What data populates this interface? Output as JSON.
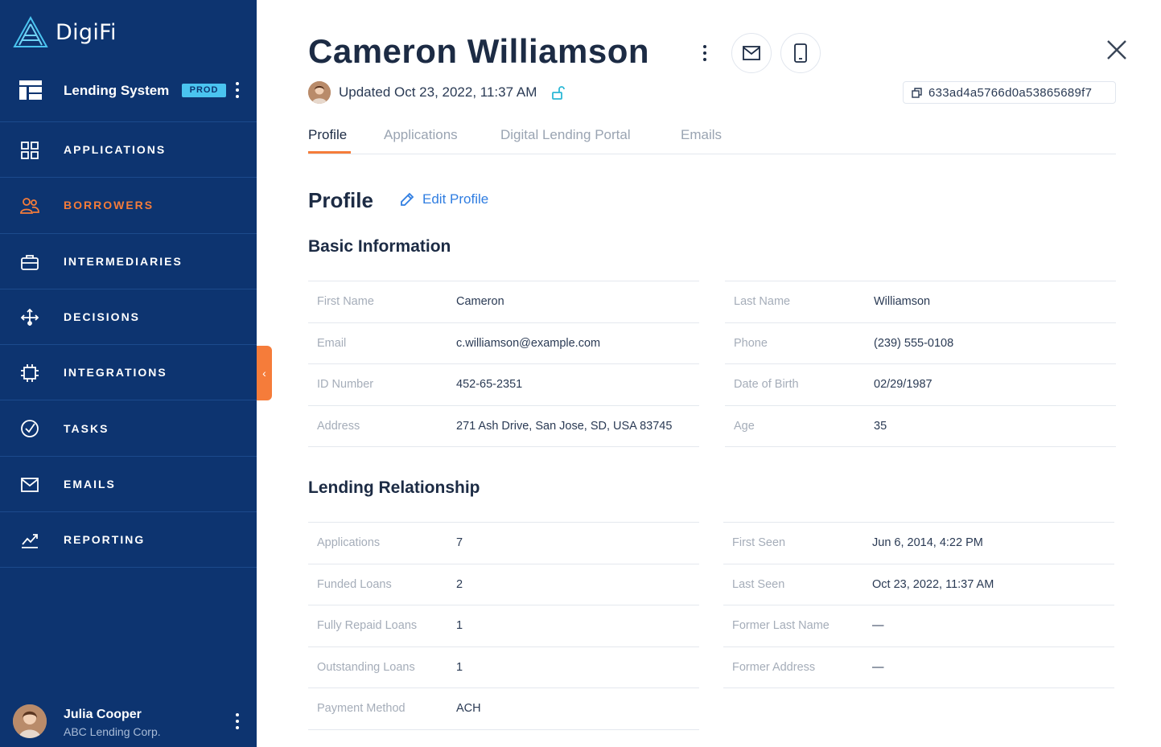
{
  "app": {
    "name": "DigiFi"
  },
  "system": {
    "name": "Lending System",
    "env_badge": "PROD"
  },
  "nav": [
    {
      "label": "APPLICATIONS",
      "icon": "grid-icon",
      "active": false
    },
    {
      "label": "BORROWERS",
      "icon": "users-icon",
      "active": true
    },
    {
      "label": "INTERMEDIARIES",
      "icon": "briefcase-icon",
      "active": false
    },
    {
      "label": "DECISIONS",
      "icon": "decision-arrows-icon",
      "active": false
    },
    {
      "label": "INTEGRATIONS",
      "icon": "chip-icon",
      "active": false
    },
    {
      "label": "TASKS",
      "icon": "check-circle-icon",
      "active": false
    },
    {
      "label": "EMAILS",
      "icon": "mail-icon",
      "active": false
    },
    {
      "label": "REPORTING",
      "icon": "chart-line-icon",
      "active": false
    }
  ],
  "user": {
    "name": "Julia Cooper",
    "org": "ABC Lending Corp."
  },
  "borrower": {
    "name": "Cameron Williamson",
    "updated": "Updated Oct 23, 2022, 11:37 AM",
    "id": "633ad4a5766d0a53865689f7"
  },
  "tabs": [
    "Profile",
    "Applications",
    "Digital Lending Portal",
    "Emails"
  ],
  "profile": {
    "title": "Profile",
    "edit_label": "Edit Profile",
    "basic_title": "Basic Information",
    "basic_left": [
      {
        "k": "First Name",
        "v": "Cameron"
      },
      {
        "k": "Email",
        "v": "c.williamson@example.com"
      },
      {
        "k": "ID Number",
        "v": "452-65-2351"
      },
      {
        "k": "Address",
        "v": "271 Ash Drive, San Jose, SD, USA 83745"
      }
    ],
    "basic_right": [
      {
        "k": "Last Name",
        "v": "Williamson"
      },
      {
        "k": "Phone",
        "v": "(239) 555-0108"
      },
      {
        "k": "Date of Birth",
        "v": "02/29/1987"
      },
      {
        "k": "Age",
        "v": "35"
      }
    ],
    "lending_title": "Lending Relationship",
    "lending_left": [
      {
        "k": "Applications",
        "v": "7"
      },
      {
        "k": "Funded Loans",
        "v": "2"
      },
      {
        "k": "Fully Repaid Loans",
        "v": "1"
      },
      {
        "k": "Outstanding Loans",
        "v": "1"
      },
      {
        "k": "Payment Method",
        "v": "ACH"
      }
    ],
    "lending_right": [
      {
        "k": "First Seen",
        "v": "Jun 6, 2014, 4:22 PM"
      },
      {
        "k": "Last Seen",
        "v": "Oct 23, 2022, 11:37 AM"
      },
      {
        "k": "Former Last Name",
        "v": "—"
      },
      {
        "k": "Former Address",
        "v": "—"
      }
    ]
  },
  "colors": {
    "sidebar": "#0d3470",
    "accent": "#f57c3a",
    "link": "#2f7de1",
    "badge": "#4ac4f0"
  }
}
